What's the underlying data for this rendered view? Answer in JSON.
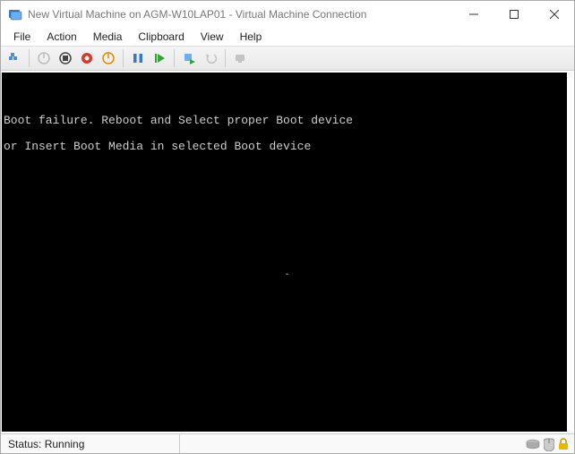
{
  "titlebar": {
    "title": "New Virtual Machine on AGM-W10LAP01 - Virtual Machine Connection"
  },
  "menu": {
    "file": "File",
    "action": "Action",
    "media": "Media",
    "clipboard": "Clipboard",
    "view": "View",
    "help": "Help"
  },
  "console": {
    "line1": "Boot failure. Reboot and Select proper Boot device",
    "line2": "or Insert Boot Media in selected Boot device"
  },
  "status": {
    "label": "Status:",
    "value": "Running"
  }
}
